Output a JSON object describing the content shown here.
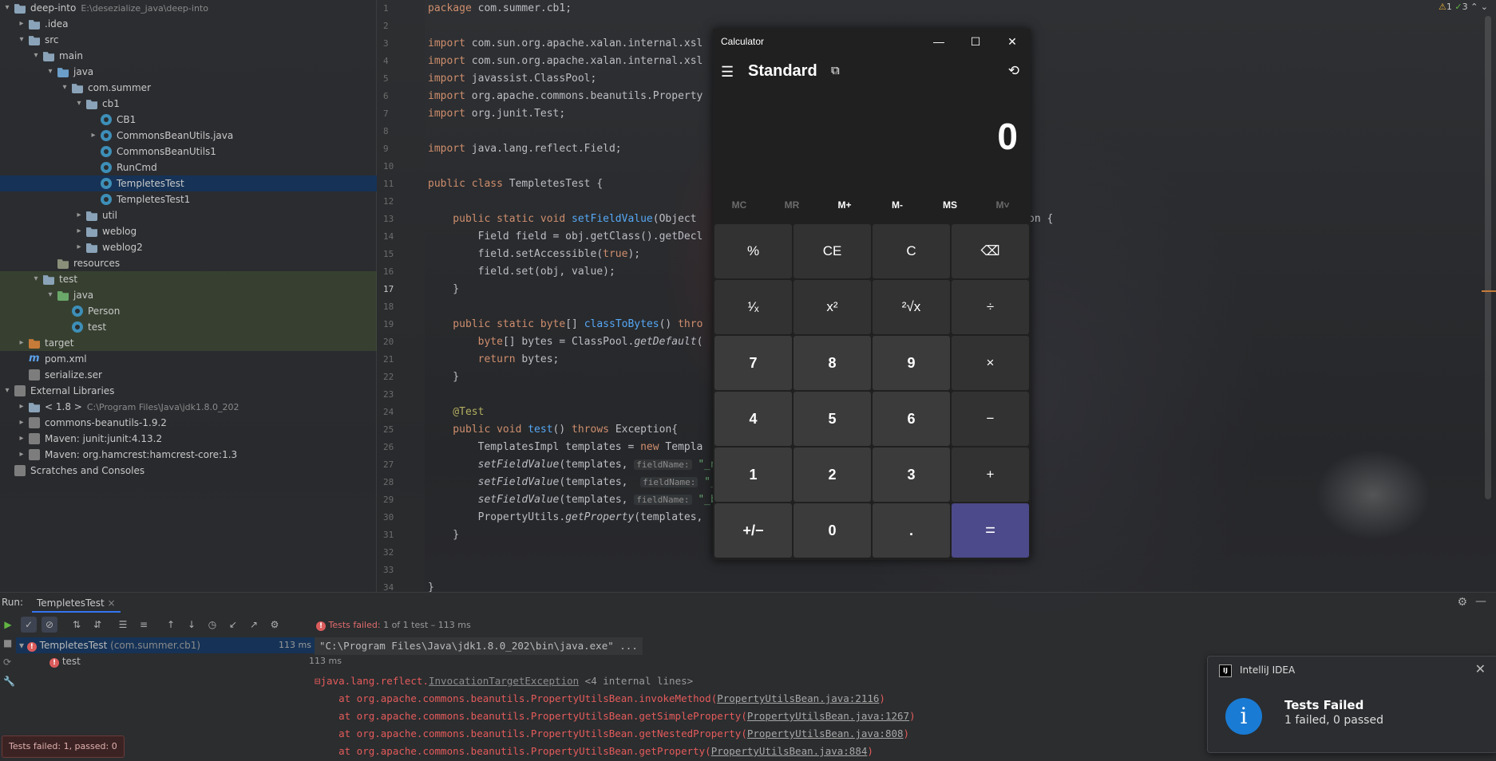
{
  "project_tree": {
    "rows": [
      {
        "label": "deep-into",
        "extra": "E:\\desezialize_java\\deep-into",
        "indent": 0,
        "arrow": "▾",
        "icon": "folder"
      },
      {
        "label": ".idea",
        "indent": 1,
        "arrow": "▸",
        "icon": "folder"
      },
      {
        "label": "src",
        "indent": 1,
        "arrow": "▾",
        "icon": "folder"
      },
      {
        "label": "main",
        "indent": 2,
        "arrow": "▾",
        "icon": "folder"
      },
      {
        "label": "java",
        "indent": 3,
        "arrow": "▾",
        "icon": "src"
      },
      {
        "label": "com.summer",
        "indent": 4,
        "arrow": "▾",
        "icon": "folder"
      },
      {
        "label": "cb1",
        "indent": 5,
        "arrow": "▾",
        "icon": "folder"
      },
      {
        "label": "CB1",
        "indent": 6,
        "arrow": "",
        "icon": "class"
      },
      {
        "label": "CommonsBeanUtils.java",
        "indent": 6,
        "arrow": "▸",
        "icon": "class"
      },
      {
        "label": "CommonsBeanUtils1",
        "indent": 6,
        "arrow": "",
        "icon": "class"
      },
      {
        "label": "RunCmd",
        "indent": 6,
        "arrow": "",
        "icon": "class"
      },
      {
        "label": "TempletesTest",
        "indent": 6,
        "arrow": "",
        "icon": "class",
        "selected": true
      },
      {
        "label": "TempletesTest1",
        "indent": 6,
        "arrow": "",
        "icon": "class"
      },
      {
        "label": "util",
        "indent": 5,
        "arrow": "▸",
        "icon": "folder"
      },
      {
        "label": "weblog",
        "indent": 5,
        "arrow": "▸",
        "icon": "folder"
      },
      {
        "label": "weblog2",
        "indent": 5,
        "arrow": "▸",
        "icon": "folder"
      },
      {
        "label": "resources",
        "indent": 3,
        "arrow": "",
        "icon": "res"
      },
      {
        "label": "test",
        "indent": 2,
        "arrow": "▾",
        "icon": "folder",
        "band": true
      },
      {
        "label": "java",
        "indent": 3,
        "arrow": "▾",
        "icon": "test",
        "band": true
      },
      {
        "label": "Person",
        "indent": 4,
        "arrow": "",
        "icon": "class",
        "band": true
      },
      {
        "label": "test",
        "indent": 4,
        "arrow": "",
        "icon": "class",
        "band": true
      },
      {
        "label": "target",
        "indent": 1,
        "arrow": "▸",
        "icon": "target",
        "band": true
      },
      {
        "label": "pom.xml",
        "indent": 1,
        "arrow": "",
        "icon": "xml"
      },
      {
        "label": "serialize.ser",
        "indent": 1,
        "arrow": "",
        "icon": "file"
      },
      {
        "label": "External Libraries",
        "indent": 0,
        "arrow": "▾",
        "icon": "lib"
      },
      {
        "label": "< 1.8 >",
        "extra": "C:\\Program Files\\Java\\jdk1.8.0_202",
        "indent": 1,
        "arrow": "▸",
        "icon": "folder"
      },
      {
        "label": "commons-beanutils-1.9.2",
        "indent": 1,
        "arrow": "▸",
        "icon": "maven"
      },
      {
        "label": "Maven: junit:junit:4.13.2",
        "indent": 1,
        "arrow": "▸",
        "icon": "maven"
      },
      {
        "label": "Maven: org.hamcrest:hamcrest-core:1.3",
        "indent": 1,
        "arrow": "▸",
        "icon": "maven"
      },
      {
        "label": "Scratches and Consoles",
        "indent": 0,
        "arrow": "",
        "icon": "scratch"
      }
    ]
  },
  "editor": {
    "line_numbers": [
      "1",
      "2",
      "3",
      "4",
      "5",
      "6",
      "7",
      "8",
      "9",
      "10",
      "11",
      "12",
      "13",
      "14",
      "15",
      "16",
      "17",
      "18",
      "19",
      "20",
      "21",
      "22",
      "23",
      "24",
      "25",
      "26",
      "27",
      "28",
      "29",
      "30",
      "31",
      "32",
      "33",
      "34"
    ],
    "current_line": "17",
    "lines": [
      [
        {
          "t": "package ",
          "c": "kw"
        },
        {
          "t": "com.summer.cb1;"
        }
      ],
      [],
      [
        {
          "t": "import ",
          "c": "kw"
        },
        {
          "t": "com.sun.org.apache.xalan.internal.xsl"
        }
      ],
      [
        {
          "t": "import ",
          "c": "kw"
        },
        {
          "t": "com.sun.org.apache.xalan.internal.xsl"
        }
      ],
      [
        {
          "t": "import ",
          "c": "kw"
        },
        {
          "t": "javassist.ClassPool;"
        }
      ],
      [
        {
          "t": "import ",
          "c": "kw"
        },
        {
          "t": "org.apache.commons.beanutils.Property"
        }
      ],
      [
        {
          "t": "import ",
          "c": "kw"
        },
        {
          "t": "org.junit.Test;"
        }
      ],
      [],
      [
        {
          "t": "import ",
          "c": "kw"
        },
        {
          "t": "java.lang.reflect.Field;"
        }
      ],
      [],
      [
        {
          "t": "public class ",
          "c": "kw"
        },
        {
          "t": "TempletesTest {"
        }
      ],
      [],
      [
        {
          "t": "    public static void ",
          "c": "kw"
        },
        {
          "t": "setFieldValue",
          "c": "fn"
        },
        {
          "t": "(Object"
        }
      ],
      [
        {
          "t": "        Field field = obj.getClass().getDecl"
        }
      ],
      [
        {
          "t": "        field.setAccessible("
        },
        {
          "t": "true",
          "c": "kw"
        },
        {
          "t": ");"
        }
      ],
      [
        {
          "t": "        field.set(obj, value);"
        }
      ],
      [
        {
          "t": "    }"
        }
      ],
      [],
      [
        {
          "t": "    public static ",
          "c": "kw"
        },
        {
          "t": "byte",
          "c": "kw"
        },
        {
          "t": "[] "
        },
        {
          "t": "classToBytes",
          "c": "fn"
        },
        {
          "t": "() "
        },
        {
          "t": "thro",
          "c": "kw"
        }
      ],
      [
        {
          "t": "        "
        },
        {
          "t": "byte",
          "c": "kw"
        },
        {
          "t": "[] bytes = ClassPool."
        },
        {
          "t": "getDefault",
          "c": "it"
        },
        {
          "t": "("
        }
      ],
      [
        {
          "t": "        "
        },
        {
          "t": "return ",
          "c": "kw"
        },
        {
          "t": "bytes;"
        }
      ],
      [
        {
          "t": "    }"
        }
      ],
      [],
      [
        {
          "t": "    @Test",
          "c": "an"
        }
      ],
      [
        {
          "t": "    public void ",
          "c": "kw"
        },
        {
          "t": "test",
          "c": "fn"
        },
        {
          "t": "() "
        },
        {
          "t": "throws ",
          "c": "kw"
        },
        {
          "t": "Exception{"
        }
      ],
      [
        {
          "t": "        TemplatesImpl templates = "
        },
        {
          "t": "new ",
          "c": "kw"
        },
        {
          "t": "Templa"
        }
      ],
      [
        {
          "t": "        "
        },
        {
          "t": "setFieldValue",
          "c": "it"
        },
        {
          "t": "(templates, "
        },
        {
          "t": "fieldName:",
          "c": "hint"
        },
        {
          "t": " \"_n",
          "c": "str"
        }
      ],
      [
        {
          "t": "        "
        },
        {
          "t": "setFieldValue",
          "c": "it"
        },
        {
          "t": "(templates,  "
        },
        {
          "t": "fieldName:",
          "c": "hint"
        },
        {
          "t": " \"_",
          "c": "str"
        }
      ],
      [
        {
          "t": "        "
        },
        {
          "t": "setFieldValue",
          "c": "it"
        },
        {
          "t": "(templates, "
        },
        {
          "t": "fieldName:",
          "c": "hint"
        },
        {
          "t": " \"_b",
          "c": "str"
        }
      ],
      [
        {
          "t": "        PropertyUtils."
        },
        {
          "t": "getProperty",
          "c": "it"
        },
        {
          "t": "(templates,"
        }
      ],
      [
        {
          "t": "    }"
        }
      ],
      [],
      [],
      [
        {
          "t": "}"
        }
      ]
    ],
    "trailing_fragment": "on {"
  },
  "inspection": {
    "warnings": "1",
    "ok": "3"
  },
  "calculator": {
    "window_title": "Calculator",
    "mode": "Standard",
    "display": "0",
    "memory": [
      "MC",
      "MR",
      "M+",
      "M-",
      "MS",
      "M˅"
    ],
    "keys": [
      [
        "%",
        "CE",
        "C",
        "⌫"
      ],
      [
        "¹⁄ₓ",
        "x²",
        "²√x",
        "÷"
      ],
      [
        "7",
        "8",
        "9",
        "×"
      ],
      [
        "4",
        "5",
        "6",
        "−"
      ],
      [
        "1",
        "2",
        "3",
        "+"
      ],
      [
        "+/−",
        "0",
        ".",
        "="
      ]
    ]
  },
  "run_panel": {
    "run_label": "Run:",
    "tab_label": "TempletesTest",
    "failed_header": "Tests failed:",
    "failed_detail": "1 of 1 test – 113 ms",
    "tests": [
      {
        "name": "TempletesTest",
        "pkg": "(com.summer.cb1)",
        "time": "113 ms"
      },
      {
        "name": "test",
        "pkg": "",
        "time": "113 ms"
      }
    ],
    "console": {
      "cmd": "\"C:\\Program Files\\Java\\jdk1.8.0_202\\bin\\java.exe\" ...",
      "exception_prefix": "java.lang.reflect.",
      "exception_link": "InvocationTargetException",
      "exception_suffix": " <4 internal lines>",
      "frames": [
        {
          "at": "    at org.apache.commons.beanutils.PropertyUtilsBean.invokeMethod(",
          "link": "PropertyUtilsBean.java:2116",
          "end": ")"
        },
        {
          "at": "    at org.apache.commons.beanutils.PropertyUtilsBean.getSimpleProperty(",
          "link": "PropertyUtilsBean.java:1267",
          "end": ")"
        },
        {
          "at": "    at org.apache.commons.beanutils.PropertyUtilsBean.getNestedProperty(",
          "link": "PropertyUtilsBean.java:808",
          "end": ")"
        },
        {
          "at": "    at org.apache.commons.beanutils.PropertyUtilsBean.getProperty(",
          "link": "PropertyUtilsBean.java:884",
          "end": ")"
        }
      ]
    },
    "status_badge": "Tests failed: 1, passed: 0"
  },
  "notification": {
    "app": "IntelliJ IDEA",
    "title": "Tests Failed",
    "subtitle": "1 failed, 0 passed"
  }
}
